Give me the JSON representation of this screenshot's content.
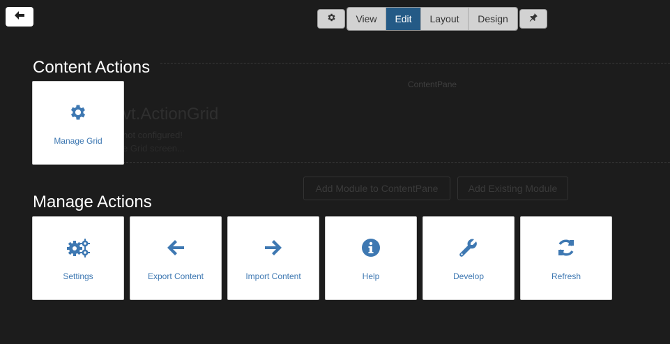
{
  "toolbar": {
    "back_icon": "arrow-left-icon",
    "gear_icon": "gear-icon",
    "pin_icon": "pin-icon",
    "modes": [
      "View",
      "Edit",
      "Layout",
      "Design"
    ],
    "active_mode": "Edit"
  },
  "background": {
    "pane_label": "ContentPane",
    "module_title": "vt.ActionGrid",
    "module_line1": "not configured!",
    "module_line2": "e Grid screen...",
    "add_module_label": "Add Module to ContentPane",
    "add_existing_label": "Add Existing Module"
  },
  "content_actions": {
    "title": "Content Actions",
    "tiles": [
      {
        "label": "Manage Grid",
        "icon": "gear-icon"
      }
    ]
  },
  "manage_actions": {
    "title": "Manage Actions",
    "tiles": [
      {
        "label": "Settings",
        "icon": "gears-icon"
      },
      {
        "label": "Export Content",
        "icon": "arrow-left-icon"
      },
      {
        "label": "Import Content",
        "icon": "arrow-right-icon"
      },
      {
        "label": "Help",
        "icon": "info-icon"
      },
      {
        "label": "Develop",
        "icon": "wrench-icon"
      },
      {
        "label": "Refresh",
        "icon": "refresh-icon"
      }
    ]
  },
  "colors": {
    "accent": "#3e78b2",
    "active_tab": "#245a86",
    "background": "#1c1c1c"
  }
}
